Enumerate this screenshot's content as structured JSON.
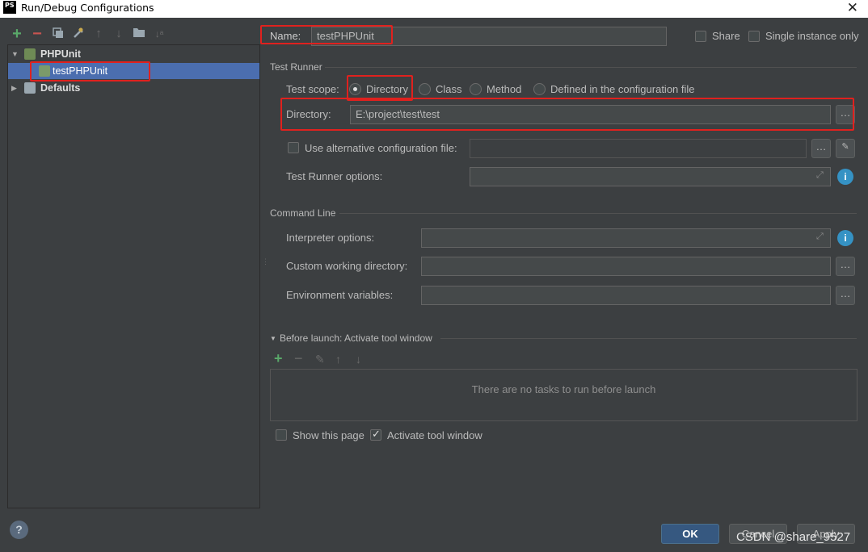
{
  "window": {
    "title": "Run/Debug Configurations",
    "app_icon": "PS"
  },
  "toolbar": {
    "icons": [
      "add-icon",
      "remove-icon",
      "copy-icon",
      "edit-defaults-icon",
      "move-up-icon",
      "move-down-icon",
      "folder-icon",
      "sort-icon"
    ]
  },
  "tree": {
    "group": "PHPUnit",
    "item": "testPHPUnit",
    "defaults": "Defaults"
  },
  "header": {
    "name_label": "Name:",
    "name_value": "testPHPUnit",
    "share_label": "Share",
    "single_instance_label": "Single instance only"
  },
  "test_runner": {
    "section_title": "Test Runner",
    "scope_label": "Test scope:",
    "scope_options": [
      "Directory",
      "Class",
      "Method",
      "Defined in the configuration file"
    ],
    "scope_selected": "Directory",
    "directory_label": "Directory:",
    "directory_value": "E:\\project\\test\\test",
    "alt_config_label": "Use alternative configuration file:",
    "runner_options_label": "Test Runner options:"
  },
  "command_line": {
    "section_title": "Command Line",
    "interpreter_label": "Interpreter options:",
    "working_dir_label": "Custom working directory:",
    "env_label": "Environment variables:"
  },
  "before_launch": {
    "title": "Before launch: Activate tool window",
    "empty_text": "There are no tasks to run before launch"
  },
  "footer": {
    "show_page_label": "Show this page",
    "activate_tool_label": "Activate tool window",
    "ok_label": "OK",
    "cancel_label": "Cancel",
    "apply_label": "Apply",
    "watermark": "CSDN @share_9527"
  },
  "colors": {
    "background": "#3c3f41",
    "selection": "#4b6eaf",
    "highlight": "#e0211e",
    "ok_button": "#365880"
  }
}
